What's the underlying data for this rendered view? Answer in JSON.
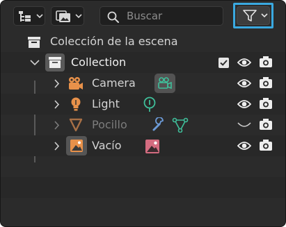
{
  "header": {
    "search_placeholder": "Buscar"
  },
  "tree": {
    "scene_label": "Colección de la escena",
    "collection": {
      "label": "Collection",
      "checked": true
    },
    "items": [
      {
        "label": "Camera",
        "dimmed": false
      },
      {
        "label": "Light",
        "dimmed": false
      },
      {
        "label": "Pocillo",
        "dimmed": true
      },
      {
        "label": "Vacío",
        "dimmed": false
      }
    ]
  },
  "colors": {
    "panel_bg": "#2b2b2b",
    "highlight_border": "#3aa9e0",
    "object_icon": "#e8914a",
    "camera_data_icon": "#3fbf9a",
    "light_data_icon": "#3fbf9a",
    "modifier_icon": "#6c9bd8",
    "mesh_data_icon": "#3fbf9a",
    "image_data_icon": "#d46c80"
  }
}
